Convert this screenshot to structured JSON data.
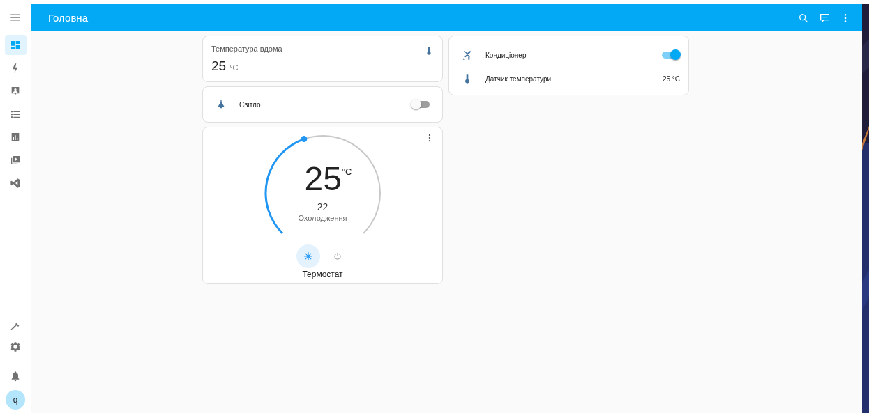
{
  "header": {
    "title": "Головна"
  },
  "sidebar": {
    "items": [
      {
        "kind": "dashboard",
        "selected": true
      },
      {
        "kind": "energy",
        "selected": false
      },
      {
        "kind": "logbook",
        "selected": false
      },
      {
        "kind": "list",
        "selected": false
      },
      {
        "kind": "history",
        "selected": false
      },
      {
        "kind": "media",
        "selected": false
      },
      {
        "kind": "code",
        "selected": false
      }
    ],
    "bottom_items": [
      {
        "kind": "tools",
        "selected": false
      },
      {
        "kind": "settings",
        "selected": false
      }
    ],
    "avatar": "q"
  },
  "sensor_card": {
    "name": "Температура вдома",
    "value": "25",
    "unit": "°C"
  },
  "light_card": {
    "name": "Світло",
    "on": false
  },
  "thermostat_card": {
    "temperature": "25",
    "unit": "°C",
    "target": "22",
    "mode": "Охолодження",
    "name": "Термостат",
    "cool_selected": true
  },
  "entities_card": {
    "rows": [
      {
        "kind": "toggle",
        "name": "Кондиціонер",
        "on": true
      },
      {
        "kind": "sensor",
        "name": "Датчик температури",
        "value": "25 °C"
      }
    ]
  }
}
